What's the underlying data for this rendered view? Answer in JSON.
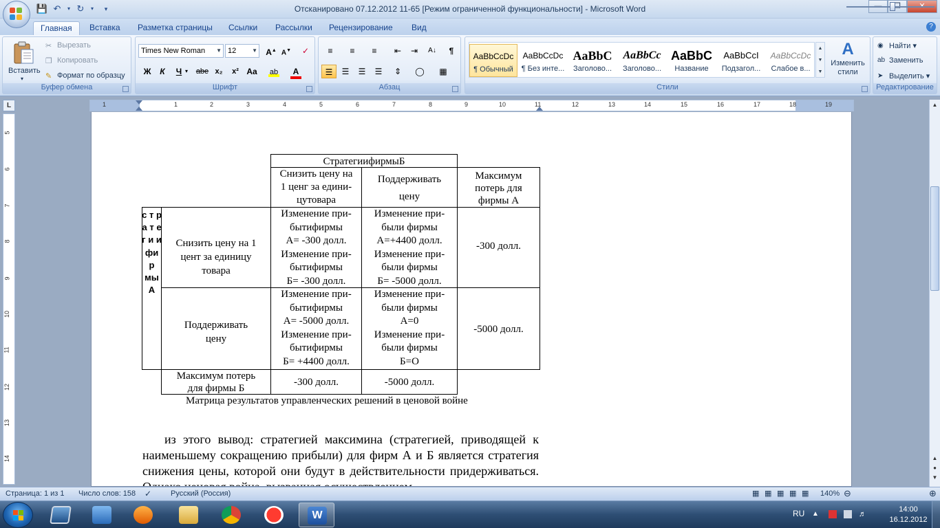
{
  "window": {
    "title": "Отсканировано 07.12.2012 11-65 [Режим ограниченной функциональности] - Microsoft Word"
  },
  "tabs": [
    {
      "label": "Главная",
      "active": true
    },
    {
      "label": "Вставка"
    },
    {
      "label": "Разметка страницы"
    },
    {
      "label": "Ссылки"
    },
    {
      "label": "Рассылки"
    },
    {
      "label": "Рецензирование"
    },
    {
      "label": "Вид"
    }
  ],
  "ribbon": {
    "clipboard": {
      "label": "Буфер обмена",
      "paste": "Вставить",
      "cut": "Вырезать",
      "copy": "Копировать",
      "format_painter": "Формат по образцу"
    },
    "font": {
      "label": "Шрифт",
      "font_name": "Times New Roman",
      "font_size": "12",
      "bold": "Ж",
      "italic": "К",
      "underline": "Ч",
      "strike": "abe",
      "subscript": "x₂",
      "superscript": "x²",
      "change_case": "Aa"
    },
    "paragraph": {
      "label": "Абзац"
    },
    "styles": {
      "label": "Стили",
      "items": [
        {
          "sample": "AaBbCcDc",
          "name": "¶ Обычный",
          "selected": true
        },
        {
          "sample": "AaBbCcDc",
          "name": "¶ Без инте..."
        },
        {
          "sample": "AaBbC",
          "name": "Заголово..."
        },
        {
          "sample": "AaBbCc",
          "name": "Заголово..."
        },
        {
          "sample": "AaBbC",
          "name": "Название"
        },
        {
          "sample": "AaBbCcI",
          "name": "Подзагол..."
        },
        {
          "sample": "AaBbCcDc",
          "name": "Слабое в..."
        }
      ],
      "change_styles": "Изменить стили"
    },
    "editing": {
      "label": "Редактирование",
      "find": "Найти",
      "replace": "Заменить",
      "select": "Выделить"
    }
  },
  "ruler": {
    "corner": "L",
    "h_numbers": [
      "1",
      "1",
      "2",
      "3",
      "4",
      "5",
      "6",
      "7",
      "8",
      "9",
      "10",
      "11",
      "12",
      "13",
      "14",
      "15",
      "16",
      "17",
      "18",
      "19"
    ],
    "v_numbers": [
      "5",
      "6",
      "7",
      "8",
      "9",
      "10",
      "11",
      "12",
      "13",
      "14"
    ]
  },
  "document": {
    "table": {
      "header_strategies_b": "СтратегиифирмыБ",
      "col1_lines": [
        "Снизить цену на",
        "1 ценг за едини-",
        "цутовара"
      ],
      "col2_lines": [
        "Поддерживать",
        "",
        "цену"
      ],
      "col3_lines": [
        "Максимум",
        "потерь для",
        "фирмы А"
      ],
      "vertical_label": [
        "с",
        "т",
        "р",
        "а",
        "т",
        "е",
        "г",
        "и",
        "и",
        "фи",
        "р",
        "мы",
        "А"
      ],
      "row1_label": [
        "Снизить цену на 1",
        "цент за единицу",
        "товара"
      ],
      "row1_c1": [
        "Изменение при-",
        "бытифирмы",
        "А= -300 долл.",
        "Изменение при-",
        "бытифирмы",
        "Б= -300 долл."
      ],
      "row1_c2": [
        "Изменение при-",
        "были фирмы",
        "А=+4400 долл.",
        "Изменение при-",
        "были фирмы",
        "Б= -5000 долл."
      ],
      "row1_c3": "-300 долл.",
      "row2_label": [
        "Поддерживать",
        "цену"
      ],
      "row2_c1": [
        "Изменение при-",
        "бытифирмы",
        "А= -5000 долл.",
        "Изменение при-",
        "бытифирмы",
        "Б= +4400 долл."
      ],
      "row2_c2": [
        "Изменение при-",
        "были фирмы",
        "А=0",
        "Изменение при-",
        "были фирмы",
        "Б=О"
      ],
      "row2_c3": "-5000 долл.",
      "row3_label": [
        "Максимум потерь",
        "для фирмы Б"
      ],
      "row3_c1": "-300 долл.",
      "row3_c2": "-5000 долл."
    },
    "caption": "Матрица результатов управленческих решений в ценовой войне",
    "paragraph": "из этого вывод: стратегией максимина (стратегией, приводящей к наименьшему сокращению прибыли) для фирм А и Б является стратегия снижения цены, которой они будут в действительности придерживаться. Однако ценовая война, вызванная осуществлением"
  },
  "statusbar": {
    "page": "Страница: 1 из 1",
    "words": "Число слов: 158",
    "language": "Русский (Россия)",
    "zoom": "140%",
    "zoom_level": 140
  },
  "taskbar": {
    "lang": "RU",
    "time": "14:00",
    "date": "16.12.2012"
  },
  "colors": {
    "ribbon_bg": "#dfe9f6",
    "accent": "#15428b",
    "taskbar": "#2e4e74"
  }
}
